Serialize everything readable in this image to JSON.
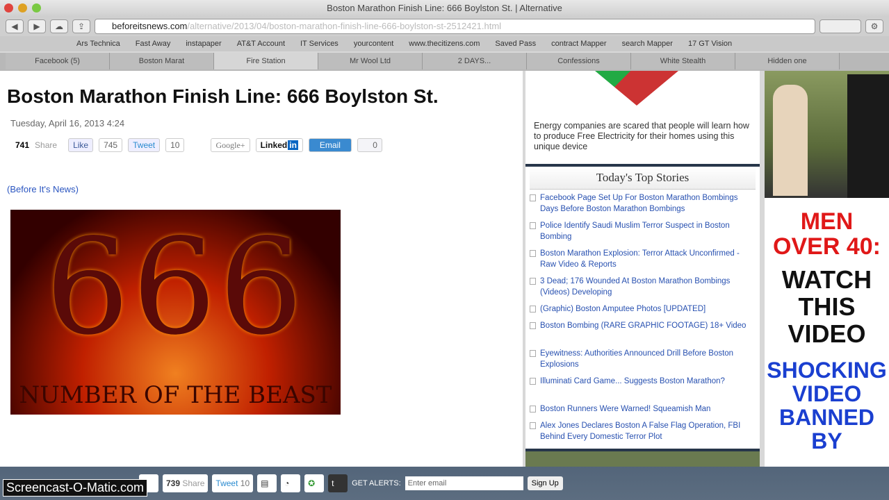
{
  "window": {
    "title": "Boston Marathon Finish Line: 666 Boylston St. | Alternative",
    "url_domain": "beforeitsnews.com",
    "url_rest": "/alternative/2013/04/boston-marathon-finish-line-666-boylston-st-2512421.html"
  },
  "bookmarks": [
    "Ars Technica",
    "Fast Away",
    "instapaper",
    "AT&T Account",
    "IT Services",
    "yourcontent",
    "www.thecitizens.com",
    "Saved Pass",
    "contract Mapper",
    "search Mapper",
    "17 GT Vision"
  ],
  "tabs": [
    "Facebook (5)",
    "Boston Marat",
    "Fire Station",
    "Mr Wool Ltd",
    "2 DAYS...",
    "Confessions",
    "White Stealth",
    "Hidden one"
  ],
  "article": {
    "title": "Boston Marathon Finish Line: 666 Boylston St.",
    "date": "Tuesday, April 16, 2013 4:24",
    "share_count": "741",
    "share_label": "Share",
    "like_label": "Like",
    "like_count": "745",
    "tweet_label": "Tweet",
    "tweet_count": "10",
    "google_label": "Google+",
    "linkedin_label": "Linked",
    "linkedin_in": "in",
    "email_label": "Email",
    "email_count": "0",
    "source": "(Before It's News)",
    "image_number": "666",
    "image_caption": "NUMBER OF THE BEAST"
  },
  "ad_energy": "Energy companies are scared that people will learn how to produce Free Electricity for their homes using this unique device",
  "top_stories": {
    "heading": "Today's Top Stories",
    "items": [
      "Facebook Page Set Up For Boston Marathon Bombings Days Before Boston Marathon Bombings",
      "Police Identify Saudi Muslim Terror Suspect in Boston Bombing",
      "Boston Marathon Explosion: Terror Attack Unconfirmed - Raw Video & Reports",
      "3 Dead; 176 Wounded At Boston Marathon Bombings (Videos) Developing",
      "(Graphic) Boston Amputee Photos [UPDATED]",
      "Boston Bombing (RARE GRAPHIC FOOTAGE) 18+ Video",
      "Eyewitness: Authorities Announced Drill Before Boston Explosions",
      "Illuminati Card Game... Suggests Boston Marathon?",
      "Boston Runners Were Warned! Squeamish Man",
      "Alex Jones Declares Boston A False Flag Operation, FBI Behind Every Domestic Terror Plot"
    ]
  },
  "right_ad": {
    "line1": "MEN OVER 40:",
    "line2": "WATCH THIS VIDEO",
    "line3": "SHOCKING VIDEO BANNED BY"
  },
  "bottom_bar": {
    "share_count": "739",
    "share_label": "Share",
    "tweet_label": "Tweet",
    "tweet_count": "10",
    "alerts_label": "GET ALERTS:",
    "email_placeholder": "Enter email",
    "signup_label": "Sign Up"
  },
  "watermark": "Screencast-O-Matic.com"
}
